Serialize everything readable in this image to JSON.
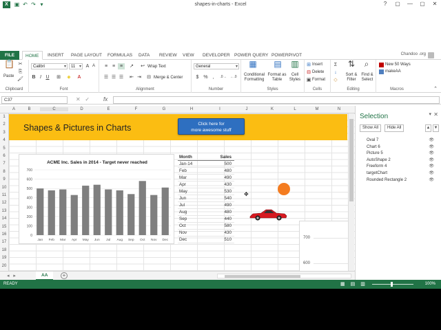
{
  "window": {
    "title": "shapes-in-charts - Excel",
    "logo": "X",
    "user": "Chandoo .org",
    "controls": [
      "?",
      "▢",
      "—",
      "▢",
      "✕"
    ]
  },
  "ribbon": {
    "tabs": [
      "FILE",
      "HOME",
      "INSERT",
      "PAGE LAYOUT",
      "FORMULAS",
      "DATA",
      "REVIEW",
      "VIEW",
      "DEVELOPER",
      "POWER QUERY",
      "POWERPIVOT"
    ],
    "active_tab": "HOME",
    "groups": {
      "clipboard": "Clipboard",
      "font": "Font",
      "alignment": "Alignment",
      "number": "Number",
      "styles": "Styles",
      "cells": "Cells",
      "editing": "Editing",
      "macros": "Macros"
    },
    "paste_label": "Paste",
    "font_name": "Calibri",
    "font_size": "11",
    "wrap_text": "Wrap Text",
    "merge_center": "Merge & Center",
    "number_format": "General",
    "conditional_formatting": "Conditional Formatting",
    "format_as_table": "Format as Table",
    "cell_styles": "Cell Styles",
    "insert": "Insert",
    "delete": "Delete",
    "format": "Format",
    "sort_filter": "Sort & Filter",
    "find_select": "Find & Select",
    "macro1": "New 50 Ways",
    "macro2": "makeAA"
  },
  "formula_bar": {
    "name_box": "C37",
    "fx": "fx",
    "value": ""
  },
  "columns": [
    "A",
    "B",
    "C",
    "D",
    "E",
    "F",
    "G",
    "H",
    "I",
    "J",
    "K",
    "L",
    "M",
    "N"
  ],
  "rows": [
    "1",
    "2",
    "3",
    "4",
    "5",
    "6",
    "7",
    "8",
    "9",
    "10",
    "11",
    "12",
    "13",
    "14",
    "15",
    "16",
    "17",
    "18",
    "19",
    "20"
  ],
  "banner": {
    "title": "Shapes & Pictures in Charts",
    "button_line1": "Click here for",
    "button_line2": "more awesome stuff",
    "color": "#fbbd12",
    "button_color": "#2e6fc0"
  },
  "chart_data": {
    "type": "bar",
    "title": "ACME Inc. Sales in 2014 - Target never reached",
    "categories": [
      "Jan",
      "Feb",
      "Mar",
      "Apr",
      "May",
      "Jun",
      "Jul",
      "Aug",
      "Sep",
      "Oct",
      "Nov",
      "Dec"
    ],
    "values": [
      500,
      480,
      490,
      430,
      530,
      540,
      490,
      480,
      440,
      580,
      430,
      510
    ],
    "ylim": [
      0,
      700
    ],
    "yticks": [
      0,
      100,
      200,
      300,
      400,
      500,
      600,
      700
    ],
    "bar_color": "#7f7f7f",
    "grid": true,
    "xlabel": "",
    "ylabel": ""
  },
  "table": {
    "headers": [
      "Month",
      "Sales"
    ],
    "rows": [
      [
        "Jan-14",
        "500"
      ],
      [
        "Feb",
        "480"
      ],
      [
        "Mar",
        "490"
      ],
      [
        "Apr",
        "430"
      ],
      [
        "May",
        "530"
      ],
      [
        "Jun",
        "540"
      ],
      [
        "Jul",
        "490"
      ],
      [
        "Aug",
        "480"
      ],
      [
        "Sep",
        "440"
      ],
      [
        "Oct",
        "580"
      ],
      [
        "Nov",
        "430"
      ],
      [
        "Dec",
        "510"
      ]
    ]
  },
  "chart2": {
    "ticks": [
      "700",
      "600"
    ]
  },
  "sheet": {
    "tabs": [
      "AA"
    ],
    "active": "AA"
  },
  "selection_pane": {
    "title": "Selection",
    "show_all": "Show All",
    "hide_all": "Hide All",
    "items": [
      "Oval 7",
      "Chart 6",
      "Picture 5",
      "AutoShape 2",
      "Freeform 4",
      "targetChart",
      "Rounded Rectangle 2"
    ]
  },
  "status": {
    "ready": "READY",
    "zoom": "100%"
  },
  "colors": {
    "excel_green": "#217346",
    "oval": "#f47c20",
    "car": "#d71920"
  }
}
